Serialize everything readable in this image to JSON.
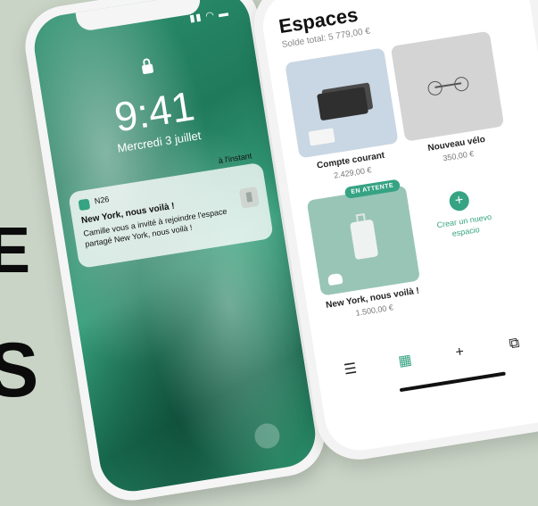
{
  "background_text": [
    "E",
    "S"
  ],
  "lock_screen": {
    "time": "9:41",
    "date": "Mercredi 3 juillet",
    "notification": {
      "app": "N26",
      "time": "à l'instant",
      "title": "New York, nous voilà !",
      "body": "Camille vous a invité à rejoindre l'espace partagé New York, nous voilà !"
    }
  },
  "espaces": {
    "title": "Espaces",
    "subtitle": "Solde total: 5 779,00 €",
    "cards": [
      {
        "label": "Compte courant",
        "value": "2.429,00 €"
      },
      {
        "label": "Nouveau vélo",
        "value": "350,00 €"
      },
      {
        "label": "New York, nous voilà !",
        "value": "1.500,00 €",
        "badge": "EN ATTENTE"
      }
    ],
    "add_label": "Crear un nuevo espacio",
    "add_icon": "+",
    "tabs": [
      {
        "icon": "list-icon",
        "glyph": "☰"
      },
      {
        "icon": "spaces-icon",
        "glyph": "▦"
      },
      {
        "icon": "plus-icon",
        "glyph": "+"
      },
      {
        "icon": "cards-icon",
        "glyph": "⧉"
      }
    ]
  },
  "colors": {
    "accent": "#36a382",
    "background": "#c9d4c6"
  }
}
